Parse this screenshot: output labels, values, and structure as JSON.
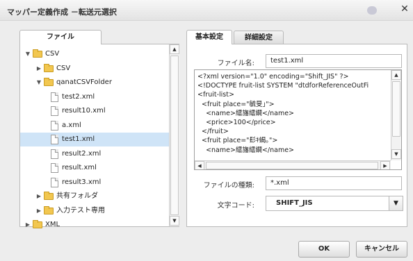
{
  "dialog": {
    "title": "マッパー定義作成 －転送元選択"
  },
  "tabs": {
    "file": "ファイル",
    "basic": "基本設定",
    "detail": "詳細設定"
  },
  "tree": {
    "items": [
      {
        "label": "CSV",
        "expanded": true,
        "type": "folder",
        "selected": false
      },
      {
        "label": "CSV",
        "expanded": false,
        "type": "folder",
        "selected": false
      },
      {
        "label": "qanatCSVFolder",
        "expanded": true,
        "type": "folder",
        "selected": false
      },
      {
        "label": "test2.xml",
        "type": "file",
        "selected": false
      },
      {
        "label": "result10.xml",
        "type": "file",
        "selected": false
      },
      {
        "label": "a.xml",
        "type": "file",
        "selected": false
      },
      {
        "label": "test1.xml",
        "type": "file",
        "selected": true
      },
      {
        "label": "result2.xml",
        "type": "file",
        "selected": false
      },
      {
        "label": "result.xml",
        "type": "file",
        "selected": false
      },
      {
        "label": "result3.xml",
        "type": "file",
        "selected": false
      },
      {
        "label": "共有フォルダ",
        "expanded": false,
        "type": "folder",
        "selected": false
      },
      {
        "label": "入力テスト専用",
        "expanded": false,
        "type": "folder",
        "selected": false
      },
      {
        "label": "XML",
        "expanded": false,
        "type": "folder",
        "selected": false
      }
    ]
  },
  "form": {
    "filename_label": "ファイル名:",
    "filename_value": "test1.xml",
    "filetype_label": "ファイルの種類:",
    "filetype_value": "*.xml",
    "encoding_label": "文字コード:",
    "encoding_value": "SHIFT_JIS"
  },
  "xml_preview": {
    "lines": [
      "<?xml version=\"1.0\" encoding=\"Shift_JIS\" ?>",
      "<!DOCTYPE fruit-list SYSTEM \"dtdforReferenceOutFi",
      "<fruit-list>",
      "  <fruit place=\"毓旻｣\">",
      "    <name>繧旛繧繝</name>",
      "    <price>100</price>",
      "  </fruit>",
      "  <fruit place=\"髟ｷ蝎｡\">",
      "    <name>繧旛繧繝</name>"
    ]
  },
  "buttons": {
    "ok": "OK",
    "cancel": "キャンセル"
  },
  "colors": {
    "selection": "#cfe4f7",
    "folder": "#f2c750"
  }
}
